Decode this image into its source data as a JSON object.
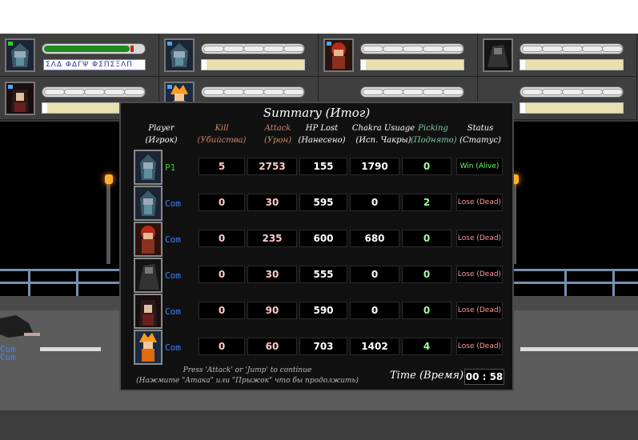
{
  "summary": {
    "title": "Summary (Итог)",
    "headers": [
      {
        "line1": "Player",
        "line2": "(Игрок)",
        "color": "#ffffff"
      },
      {
        "line1": "Kill",
        "line2": "(Убийства)",
        "color": "#d08a6a"
      },
      {
        "line1": "Attack",
        "line2": "(Урон)",
        "color": "#d08a6a"
      },
      {
        "line1": "HP Lost",
        "line2": "(Нанесено)",
        "color": "#ffffff"
      },
      {
        "line1": "Chakra Usuage",
        "line2": "(Исп. Чакры)",
        "color": "#ffffff"
      },
      {
        "line1": "Picking",
        "line2": "(Поднято)",
        "color": "#7fd0a0"
      },
      {
        "line1": "Status",
        "line2": "(Статус)",
        "color": "#ffffff"
      }
    ],
    "rows": [
      {
        "player": "P1",
        "kill": "5",
        "attack": "2753",
        "hp_lost": "155",
        "chakra": "1790",
        "picking": "0",
        "status": "Win (Alive)",
        "portrait": "masked-ninja"
      },
      {
        "player": "Com",
        "kill": "0",
        "attack": "30",
        "hp_lost": "595",
        "chakra": "0",
        "picking": "2",
        "status": "Lose (Dead)",
        "portrait": "masked-ninja"
      },
      {
        "player": "Com",
        "kill": "0",
        "attack": "235",
        "hp_lost": "600",
        "chakra": "680",
        "picking": "0",
        "status": "Lose (Dead)",
        "portrait": "red-hair-ninja"
      },
      {
        "player": "Com",
        "kill": "0",
        "attack": "30",
        "hp_lost": "555",
        "chakra": "0",
        "picking": "0",
        "status": "Lose (Dead)",
        "portrait": "dark-cloak-ninja"
      },
      {
        "player": "Com",
        "kill": "0",
        "attack": "90",
        "hp_lost": "590",
        "chakra": "0",
        "picking": "0",
        "status": "Lose (Dead)",
        "portrait": "long-hair-ninja"
      },
      {
        "player": "Com",
        "kill": "0",
        "attack": "60",
        "hp_lost": "703",
        "chakra": "1402",
        "picking": "4",
        "status": "Lose (Dead)",
        "portrait": "orange-hair-ninja"
      }
    ],
    "footer_line1": "Press 'Attack' or 'Jump' to continue",
    "footer_line2": "(Нажмите \"Атака\" или \"Прыжок\" что бы продолжить)",
    "time_label": "Time (Время):",
    "time_value": "00 : 58"
  },
  "hud": {
    "p1_text": "ΣΛΔ ΦΔΓΨ ΦΣΠΣΞΛΠ",
    "p1_hp_fraction": 0.86,
    "panels": [
      {
        "portrait": "masked-ninja",
        "player": "p1"
      },
      {
        "portrait": "masked-ninja",
        "player": "com"
      },
      {
        "portrait": "red-hair-ninja",
        "player": "com"
      },
      {
        "portrait": "dark-cloak-ninja",
        "player": "com"
      },
      {
        "portrait": "long-hair-ninja",
        "player": "com"
      },
      {
        "portrait": "orange-hair-ninja",
        "player": "com"
      }
    ]
  },
  "stage": {
    "com_label_1": "Com",
    "com_label_2": "Com"
  },
  "colors": {
    "p1": "#33cc33",
    "com": "#3a86ff",
    "value_pink": "#ffc8c8",
    "value_white": "#ffffff",
    "value_green": "#a0ffa0",
    "win": "#66ff66",
    "lose": "#ff9a9a"
  }
}
